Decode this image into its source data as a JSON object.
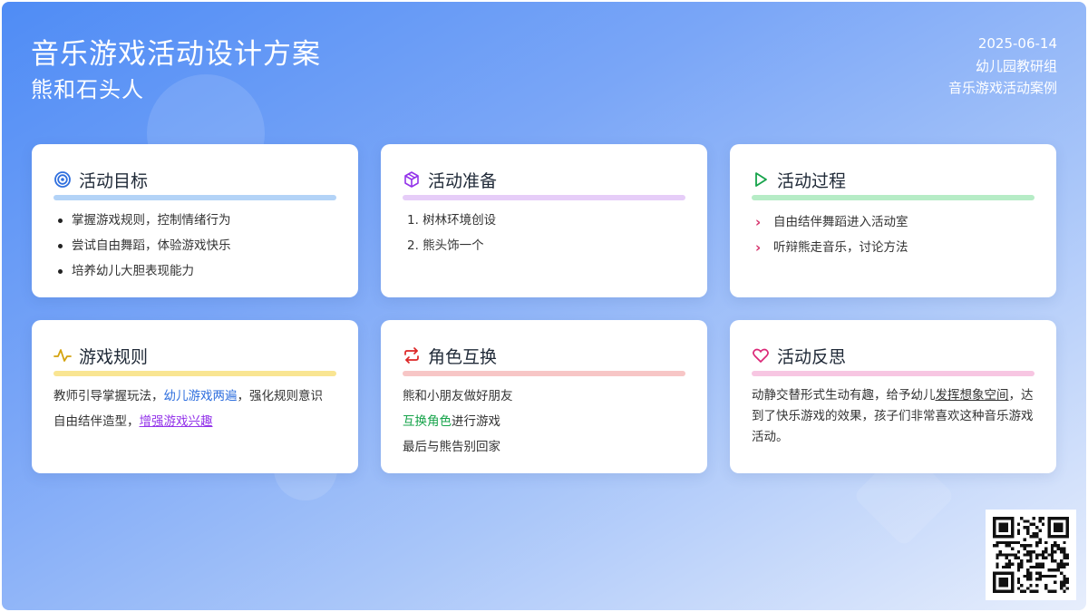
{
  "header": {
    "title": "音乐游戏活动设计方案",
    "subtitle": "熊和石头人",
    "date": "2025-06-14",
    "author": "幼儿园教研组",
    "category": "音乐游戏活动案例"
  },
  "cards": {
    "goals": {
      "title": "活动目标",
      "icon": "target-icon",
      "color": "#b3d3f7",
      "items": [
        "掌握游戏规则，控制情绪行为",
        "尝试自由舞蹈，体验游戏快乐",
        "培养幼儿大胆表现能力"
      ]
    },
    "prep": {
      "title": "活动准备",
      "icon": "box-icon",
      "color": "#e6cdf8",
      "items": [
        "1. 树林环境创设",
        "2. 熊头饰一个"
      ]
    },
    "process": {
      "title": "活动过程",
      "icon": "play-icon",
      "color": "#b6ecc6",
      "items": [
        "自由结伴舞蹈进入活动室",
        "听辩熊走音乐，讨论方法"
      ]
    },
    "rules": {
      "title": "游戏规则",
      "icon": "activity-icon",
      "color": "#f9e592",
      "line1_a": "教师引导掌握玩法，",
      "line1_b": "幼儿游戏两遍",
      "line1_c": "，强化规则意识",
      "line2_a": "自由结伴造型，",
      "line2_b": "增强游戏兴趣"
    },
    "roles": {
      "title": "角色互换",
      "icon": "repeat-icon",
      "color": "#f7c6c6",
      "line1": "熊和小朋友做好朋友",
      "line2_a": "互换角色",
      "line2_b": "进行游戏",
      "line3": "最后与熊告别回家"
    },
    "reflect": {
      "title": "活动反思",
      "icon": "heart-icon",
      "color": "#f7c6e2",
      "text_a": "动静交替形式生动有趣，给予幼儿",
      "text_b": "发挥想象空间",
      "text_c": "，达到了快乐游戏的效果，孩子们非常喜欢这种音乐游戏活动。"
    }
  },
  "qr": {
    "icon": "qr-code-icon"
  }
}
